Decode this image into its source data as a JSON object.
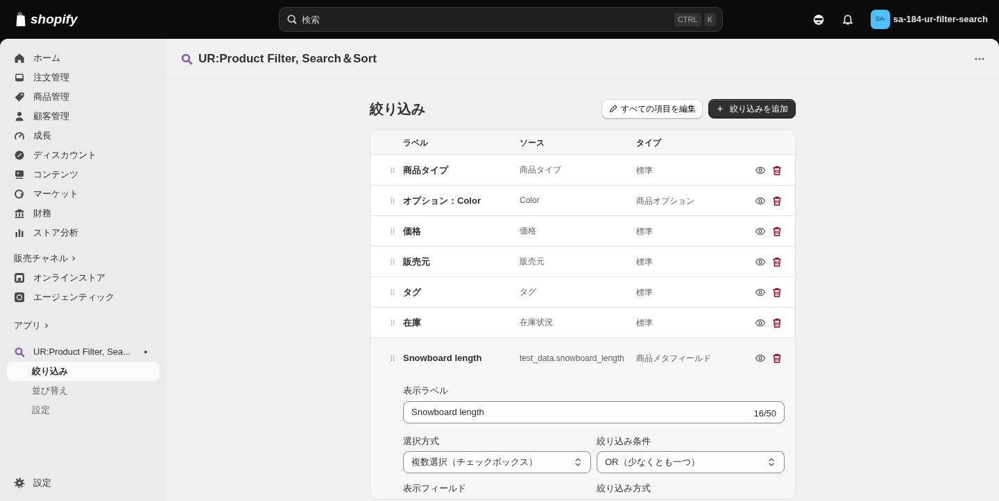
{
  "topbar": {
    "logo": "shopify",
    "search": {
      "placeholder": "検索",
      "keys": [
        "CTRL",
        "K"
      ]
    },
    "store": {
      "avatar": "SA-",
      "name": "sa-184-ur-filter-search"
    }
  },
  "sidebar": {
    "items": [
      {
        "label": "ホーム"
      },
      {
        "label": "注文管理"
      },
      {
        "label": "商品管理"
      },
      {
        "label": "顧客管理"
      },
      {
        "label": "成長"
      },
      {
        "label": "ディスカウント"
      },
      {
        "label": "コンテンツ"
      },
      {
        "label": "マーケット"
      },
      {
        "label": "財務"
      },
      {
        "label": "ストア分析"
      }
    ],
    "sales_channels": {
      "heading": "販売チャネル",
      "items": [
        {
          "label": "オンラインストア"
        },
        {
          "label": "エージェンティック"
        }
      ]
    },
    "apps": {
      "heading": "アプリ",
      "app": {
        "name": "UR:Product Filter, Sea...",
        "children": [
          {
            "label": "絞り込み",
            "selected": true
          },
          {
            "label": "並び替え",
            "selected": false
          },
          {
            "label": "設定",
            "selected": false
          }
        ]
      }
    },
    "footer": {
      "label": "設定"
    }
  },
  "page": {
    "app_title": "UR:Product Filter, Search＆Sort",
    "heading": "絞り込み",
    "buttons": [
      {
        "label": "すべての項目を編集",
        "kind": "secondary"
      },
      {
        "label": "絞り込みを追加",
        "kind": "primary"
      }
    ]
  },
  "table": {
    "columns": [
      "ラベル",
      "ソース",
      "タイプ"
    ],
    "rows": [
      {
        "label": "商品タイプ",
        "source": "商品タイプ",
        "type": "標準",
        "expanded": false
      },
      {
        "label": "オプション：Color",
        "source": "Color",
        "type": "商品オプション",
        "expanded": false
      },
      {
        "label": "価格",
        "source": "価格",
        "type": "標準",
        "expanded": false
      },
      {
        "label": "販売元",
        "source": "販売元",
        "type": "標準",
        "expanded": false
      },
      {
        "label": "タグ",
        "source": "タグ",
        "type": "標準",
        "expanded": false
      },
      {
        "label": "在庫",
        "source": "在庫状況",
        "type": "標準",
        "expanded": false
      },
      {
        "label": "Snowboard length",
        "source": "test_data.snowboard_length",
        "type": "商品メタフィールド",
        "expanded": true
      }
    ]
  },
  "detail": {
    "display_label": {
      "label": "表示ラベル",
      "value": "Snowboard length",
      "counter": "16/50"
    },
    "selects": [
      {
        "label": "選択方式",
        "value": "複数選択（チェックボックス）"
      },
      {
        "label": "絞り込み条件",
        "value": "OR（少なくとも一つ）"
      }
    ],
    "next_labels": [
      "表示フィールド",
      "絞り込み方式"
    ]
  }
}
